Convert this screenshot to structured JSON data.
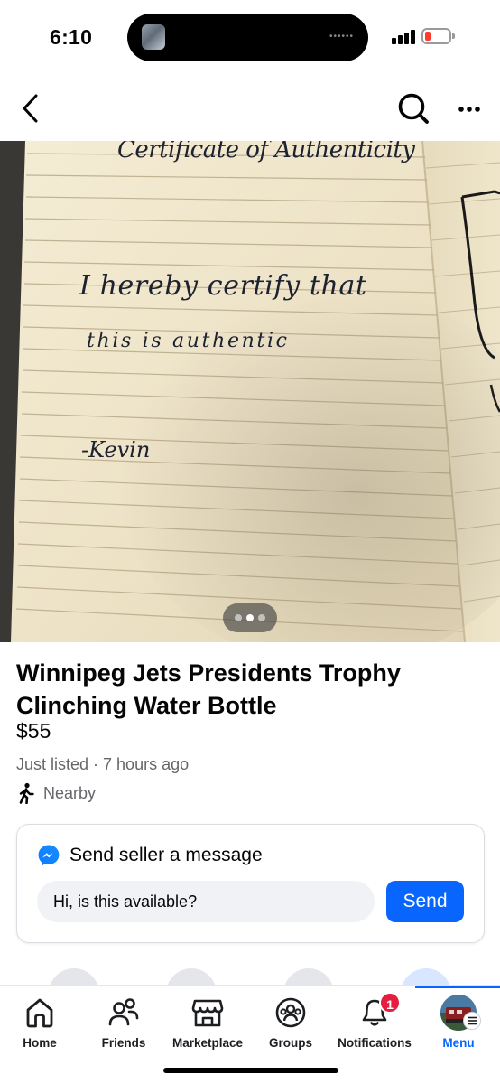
{
  "status": {
    "time": "6:10",
    "battery_color": "#ff3b30"
  },
  "nav": {
    "back_icon": "chevron-left-icon",
    "search_icon": "search-icon",
    "more_icon": "more-icon"
  },
  "photo": {
    "handwriting": {
      "heading": "Certificate of Authenticity",
      "line1": "I hereby certify that",
      "line2": "this is authentic",
      "signature": "-Kevin"
    },
    "pager": {
      "count": 3,
      "active_index": 1
    }
  },
  "listing": {
    "title": "Winnipeg Jets Presidents Trophy Clinching Water Bottle",
    "price": "$55",
    "meta": "Just listed · 7 hours ago",
    "location": "Nearby"
  },
  "message": {
    "heading": "Send seller a message",
    "input_value": "Hi, is this available?",
    "send_label": "Send",
    "accent": "#0866ff"
  },
  "tabs": [
    {
      "label": "Home",
      "icon": "home-icon"
    },
    {
      "label": "Friends",
      "icon": "friends-icon"
    },
    {
      "label": "Marketplace",
      "icon": "marketplace-icon"
    },
    {
      "label": "Groups",
      "icon": "groups-icon"
    },
    {
      "label": "Notifications",
      "icon": "bell-icon",
      "badge": "1"
    },
    {
      "label": "Menu",
      "icon": "profile-avatar",
      "active": true
    }
  ]
}
